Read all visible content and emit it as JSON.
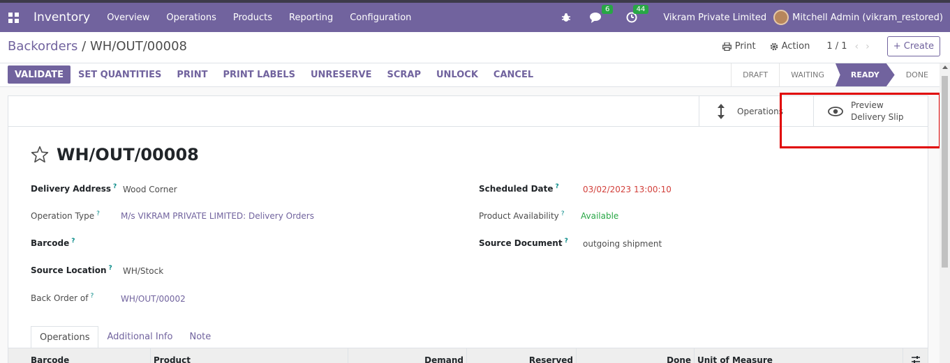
{
  "navbar": {
    "app_name": "Inventory",
    "menu": [
      "Overview",
      "Operations",
      "Products",
      "Reporting",
      "Configuration"
    ],
    "messages_count": "6",
    "activities_count": "44",
    "company": "Vikram Private Limited",
    "user": "Mitchell Admin (vikram_restored)"
  },
  "control": {
    "breadcrumb_parent": "Backorders",
    "breadcrumb_sep": " / ",
    "breadcrumb_current": "WH/OUT/00008",
    "print_label": "Print",
    "action_label": "Action",
    "pager": "1 / 1",
    "create_label": "Create"
  },
  "actions": [
    "VALIDATE",
    "SET QUANTITIES",
    "PRINT",
    "PRINT LABELS",
    "UNRESERVE",
    "SCRAP",
    "UNLOCK",
    "CANCEL"
  ],
  "stages": [
    "DRAFT",
    "WAITING",
    "READY",
    "DONE"
  ],
  "active_stage": "READY",
  "smart_buttons": {
    "operations": "Operations",
    "preview_line1": "Preview",
    "preview_line2": "Delivery Slip"
  },
  "record": {
    "title": "WH/OUT/00008",
    "left_fields": [
      {
        "label": "Delivery Address",
        "value": "Wood Corner"
      },
      {
        "label": "Operation Type",
        "value": "M/s VIKRAM PRIVATE LIMITED: Delivery Orders"
      },
      {
        "label": "Barcode",
        "value": ""
      },
      {
        "label": "Source Location",
        "value": "WH/Stock"
      },
      {
        "label": "Back Order of",
        "value": "WH/OUT/00002"
      }
    ],
    "right_fields": [
      {
        "label": "Scheduled Date",
        "value": "03/02/2023 13:00:10"
      },
      {
        "label": "Product Availability",
        "value": "Available"
      },
      {
        "label": "Source Document",
        "value": "outgoing shipment"
      }
    ],
    "help_mark": "?"
  },
  "tabs": [
    "Operations",
    "Additional Info",
    "Note"
  ],
  "table_columns": [
    "Barcode",
    "Product",
    "Demand",
    "Reserved",
    "Done",
    "Unit of Measure"
  ],
  "colors": {
    "brand": "#71639e",
    "highlight": "#e00000",
    "date_red": "#d23f3a",
    "available_green": "#28a745"
  }
}
